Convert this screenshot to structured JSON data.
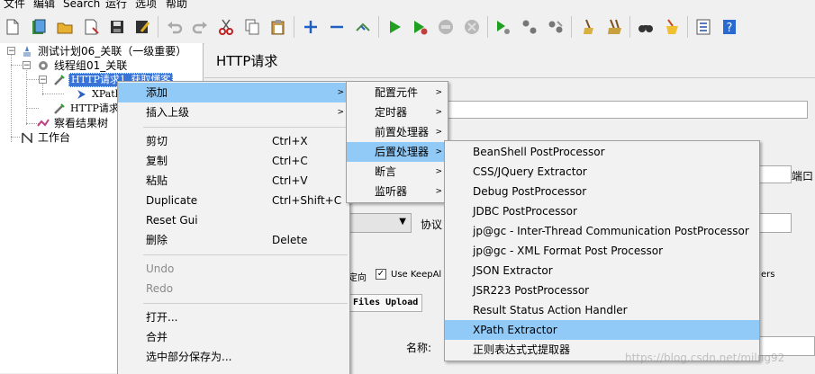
{
  "menubar": [
    "文件",
    "编辑",
    "Search",
    "运行",
    "选项",
    "帮助"
  ],
  "tree": {
    "root": "测试计划06_关联（一级重要）",
    "thread_group": "线程组01_关联",
    "http1": "HTTP请求1_获取懂客",
    "xpath": "XPath",
    "http2": "HTTP请求",
    "view_results": "察看结果树",
    "workbench": "工作台"
  },
  "panel": {
    "title": "HTTP请求",
    "port_label": "端口",
    "protocol_label": "协议",
    "keepalive_label": "Use KeepAl",
    "redirect_fragment": "定向",
    "files_upload": "Files Upload",
    "name_label": "名称:",
    "headers_fragment": "ers"
  },
  "context_menu": [
    {
      "label": "添加",
      "submenu": true
    },
    {
      "label": "插入上级",
      "submenu": true
    },
    {
      "label": "剪切",
      "shortcut": "Ctrl+X"
    },
    {
      "label": "复制",
      "shortcut": "Ctrl+C"
    },
    {
      "label": "粘贴",
      "shortcut": "Ctrl+V"
    },
    {
      "label": "Duplicate",
      "shortcut": "Ctrl+Shift+C"
    },
    {
      "label": "Reset Gui"
    },
    {
      "label": "删除",
      "shortcut": "Delete"
    },
    {
      "label": "Undo"
    },
    {
      "label": "Redo"
    },
    {
      "label": "打开..."
    },
    {
      "label": "合并"
    },
    {
      "label": "选中部分保存为..."
    }
  ],
  "add_submenu": [
    "配置元件",
    "定时器",
    "前置处理器",
    "后置处理器",
    "断言",
    "监听器"
  ],
  "post_processors": [
    "BeanShell PostProcessor",
    "CSS/JQuery Extractor",
    "Debug PostProcessor",
    "JDBC PostProcessor",
    "jp@gc - Inter-Thread Communication PostProcessor",
    "jp@gc - XML Format Post Processor",
    "JSON Extractor",
    "JSR223 PostProcessor",
    "Result Status Action Handler",
    "XPath Extractor",
    "正则表达式式提取器"
  ],
  "watermark": "https://blog.csdn.net/milng92"
}
